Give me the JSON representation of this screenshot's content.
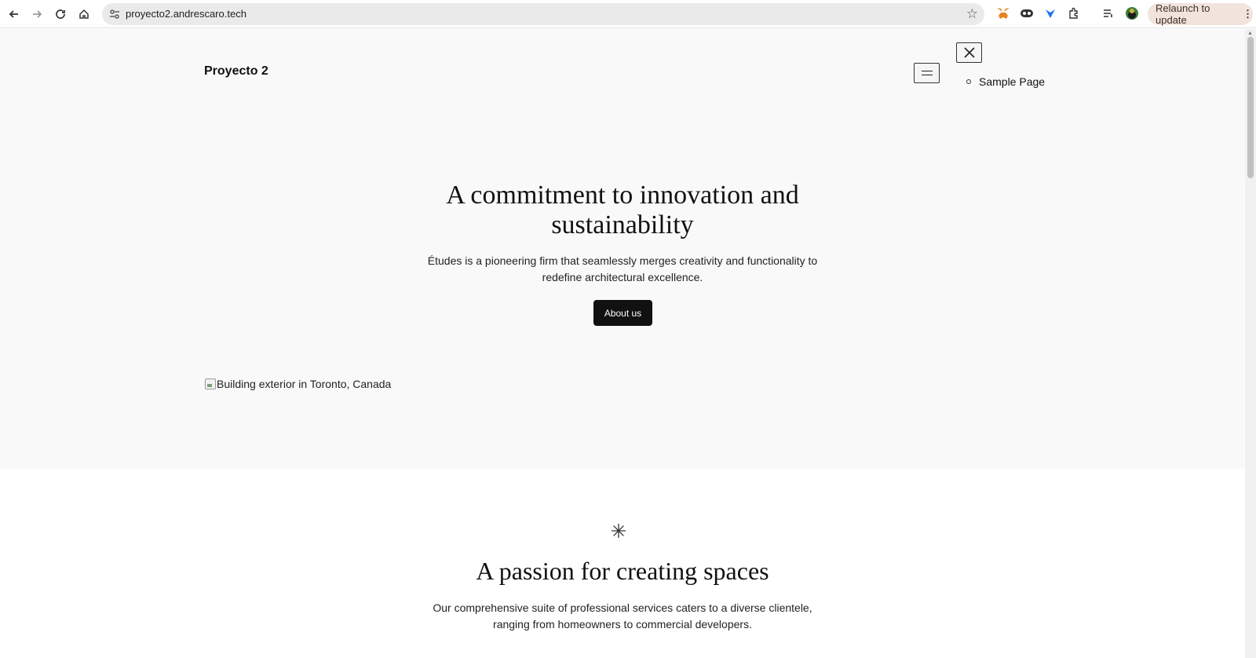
{
  "browser": {
    "url": "proyecto2.andrescaro.tech",
    "relaunch_label": "Relaunch to update",
    "icons": [
      "back-icon",
      "forward-icon",
      "reload-icon",
      "home-icon",
      "site-info-icon",
      "bookmark-star-icon",
      "metamask-icon",
      "extension-icon-2",
      "extension-icon-3",
      "extensions-puzzle-icon",
      "media-queue-icon",
      "profile-avatar-icon"
    ]
  },
  "site": {
    "title": "Proyecto 2",
    "menu": {
      "items": [
        "Sample Page"
      ]
    }
  },
  "hero": {
    "title": "A commitment to innovation and sustainability",
    "description": "Études is a pioneering firm that seamlessly merges creativity and functionality to redefine architectural excellence.",
    "button_label": "About us",
    "image_alt": "Building exterior in Toronto, Canada"
  },
  "section": {
    "icon": "asterisk-icon",
    "title": "A passion for creating spaces",
    "description": "Our comprehensive suite of professional services caters to a diverse clientele, ranging from homeowners to commercial developers."
  },
  "colors": {
    "hero_background": "#f9f9f9",
    "button_background": "#111111",
    "relaunch_background": "#f3e3dd"
  }
}
